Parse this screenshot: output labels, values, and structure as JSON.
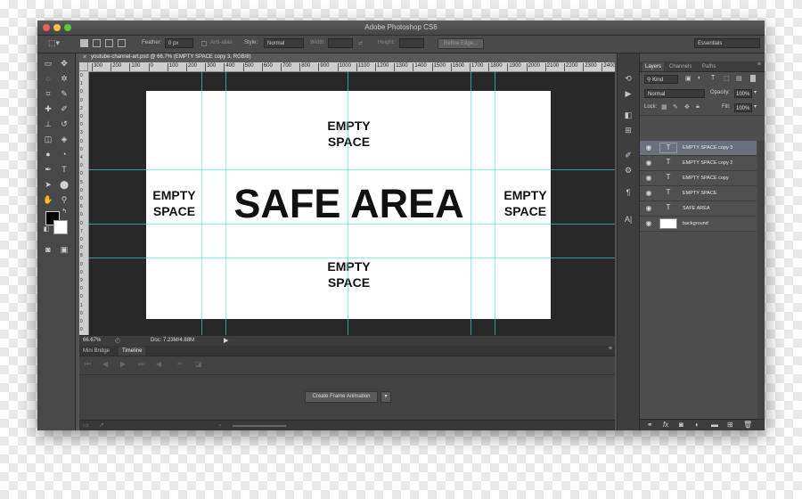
{
  "window": {
    "title": "Adobe Photoshop CS6",
    "traffic_colors": [
      "#ee5f57",
      "#f5be4f",
      "#5fc640"
    ]
  },
  "options_bar": {
    "feather_label": "Feather:",
    "feather_value": "0 px",
    "anti_alias_label": "Anti-alias",
    "style_label": "Style:",
    "style_value": "Normal",
    "width_label": "Width:",
    "height_label": "Height:",
    "refine_edge_label": "Refine Edge...",
    "workspace_value": "Essentials"
  },
  "document": {
    "tab_title": "youtube-channel-art.psd @ 66.7% (EMPTY SPACE copy 3, RGB/8)",
    "ruler_h": [
      "300",
      "200",
      "100",
      "0",
      "100",
      "200",
      "300",
      "400",
      "500",
      "600",
      "700",
      "800",
      "900",
      "1000",
      "1100",
      "1200",
      "1300",
      "1400",
      "1500",
      "1600",
      "1700",
      "1800",
      "1900",
      "2000",
      "2100",
      "2200",
      "2300",
      "2400"
    ],
    "ruler_v": [
      "0",
      "1",
      "0",
      "0",
      "2",
      "0",
      "0",
      "3",
      "0",
      "0",
      "4",
      "0",
      "0",
      "5",
      "0",
      "0",
      "6",
      "0",
      "0",
      "7",
      "0",
      "0",
      "8",
      "0",
      "0",
      "9",
      "0",
      "0",
      "1",
      "0",
      "0",
      "0"
    ],
    "canvas": {
      "top_text_1": "EMPTY",
      "top_text_2": "SPACE",
      "left_text_1": "EMPTY",
      "left_text_2": "SPACE",
      "center_text": "SAFE AREA",
      "right_text_1": "EMPTY",
      "right_text_2": "SPACE",
      "bottom_text_1": "EMPTY",
      "bottom_text_2": "SPACE"
    },
    "zoom": "66.67%",
    "doc_info": "Doc: 7.23M/4.88M"
  },
  "timeline": {
    "tab_mini_bridge": "Mini Bridge",
    "tab_timeline": "Timeline",
    "create_button": "Create Frame Animation"
  },
  "layers_panel": {
    "tabs": [
      "Layers",
      "Channels",
      "Paths"
    ],
    "kind_label": "Kind",
    "blend_mode": "Normal",
    "opacity_label": "Opacity:",
    "opacity_value": "100%",
    "lock_label": "Lock:",
    "fill_label": "Fill:",
    "fill_value": "100%",
    "layers": [
      "EMPTY SPACE copy 3",
      "EMPTY SPACE copy 2",
      "EMPTY SPACE copy",
      "EMPTY SPACE",
      "SAFE AREA",
      "background"
    ],
    "selected_index": 0
  },
  "colors": {
    "guide": "#38e7e7",
    "foreground": "#000000",
    "background": "#ffffff",
    "selected_row": "#6b7080"
  }
}
